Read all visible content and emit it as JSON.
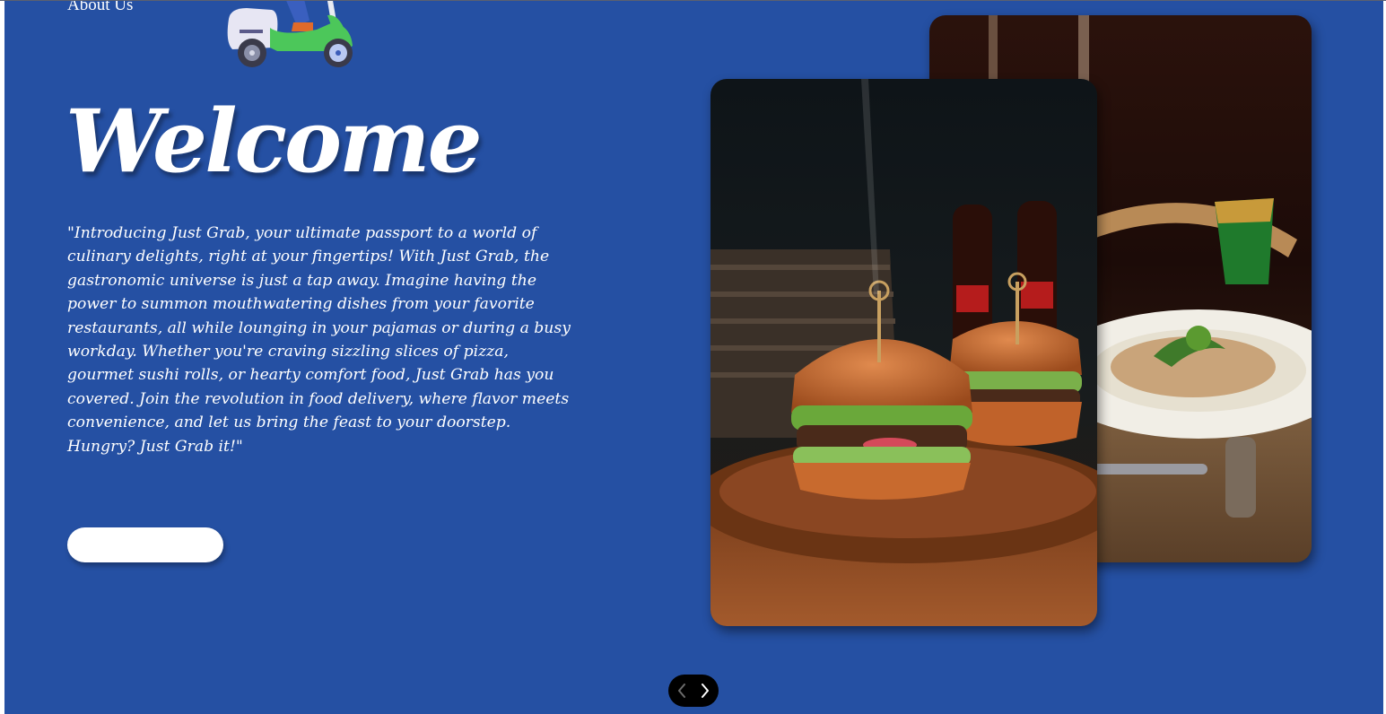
{
  "nav": {
    "about_label": "About Us"
  },
  "hero": {
    "heading": "Welcome",
    "description": "\"Introducing Just Grab, your ultimate passport to a world of culinary delights, right at your fingertips! With Just Grab, the gastronomic universe is just a tap away. Imagine having the power to summon mouthwatering dishes from your favorite restaurants, all while lounging in your pajamas or during a busy workday. Whether you're craving sizzling slices of pizza, gourmet sushi rolls, or hearty comfort food, Just Grab has you covered. Join the revolution in food delivery, where flavor meets convenience, and let us bring the feast to your doorstep. Hungry? Just Grab it!\"",
    "cta_label": ""
  },
  "gallery": {
    "cards": [
      {
        "subject": "burger-with-cola-bottles"
      },
      {
        "subject": "pasta-plate-restaurant-table"
      }
    ]
  },
  "slider": {
    "prev_icon": "chevron-left-icon",
    "next_icon": "chevron-right-icon"
  },
  "colors": {
    "hero_background": "#2550a3",
    "text": "#ffffff",
    "cta_background": "#ffffff",
    "slider_background": "#000000",
    "scooter_body": "#4cc75a"
  }
}
